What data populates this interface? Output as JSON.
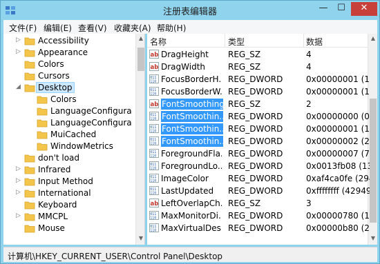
{
  "window": {
    "title": "注册表编辑器",
    "min": "—",
    "max": "☐",
    "close": "✕"
  },
  "menu": [
    "文件(F)",
    "编辑(E)",
    "查看(V)",
    "收藏夹(A)",
    "帮助(H)"
  ],
  "tree": [
    {
      "label": "Accessibility",
      "level": 1,
      "expand": "▷"
    },
    {
      "label": "Appearance",
      "level": 1,
      "expand": "▷"
    },
    {
      "label": "Colors",
      "level": 1,
      "expand": ""
    },
    {
      "label": "Cursors",
      "level": 1,
      "expand": ""
    },
    {
      "label": "Desktop",
      "level": 1,
      "expand": "◢",
      "selected": true
    },
    {
      "label": "Colors",
      "level": 2,
      "expand": ""
    },
    {
      "label": "LanguageConfigura",
      "level": 2,
      "expand": ""
    },
    {
      "label": "LanguageConfigura",
      "level": 2,
      "expand": ""
    },
    {
      "label": "MuiCached",
      "level": 2,
      "expand": ""
    },
    {
      "label": "WindowMetrics",
      "level": 2,
      "expand": ""
    },
    {
      "label": "don't load",
      "level": 1,
      "expand": ""
    },
    {
      "label": "Infrared",
      "level": 1,
      "expand": "▷"
    },
    {
      "label": "Input Method",
      "level": 1,
      "expand": "▷"
    },
    {
      "label": "International",
      "level": 1,
      "expand": "▷"
    },
    {
      "label": "Keyboard",
      "level": 1,
      "expand": ""
    },
    {
      "label": "MMCPL",
      "level": 1,
      "expand": "▷"
    },
    {
      "label": "Mouse",
      "level": 1,
      "expand": ""
    }
  ],
  "columns": {
    "name": "名称",
    "type": "类型",
    "data": "数据"
  },
  "rows": [
    {
      "icon": "ab",
      "name": "DragHeight",
      "type": "REG_SZ",
      "data": "4"
    },
    {
      "icon": "ab",
      "name": "DragWidth",
      "type": "REG_SZ",
      "data": "4"
    },
    {
      "icon": "bin",
      "name": "FocusBorderH...",
      "type": "REG_DWORD",
      "data": "0x00000001 (1)"
    },
    {
      "icon": "bin",
      "name": "FocusBorderW...",
      "type": "REG_DWORD",
      "data": "0x00000001 (1)"
    },
    {
      "icon": "ab",
      "name": "FontSmoothing",
      "type": "REG_SZ",
      "data": "2",
      "selected": true
    },
    {
      "icon": "bin",
      "name": "FontSmoothin...",
      "type": "REG_DWORD",
      "data": "0x00000000 (0)",
      "selected": true
    },
    {
      "icon": "bin",
      "name": "FontSmoothin...",
      "type": "REG_DWORD",
      "data": "0x00000001 (1)",
      "selected": true
    },
    {
      "icon": "bin",
      "name": "FontSmoothin...",
      "type": "REG_DWORD",
      "data": "0x00000002 (2)",
      "selected": true
    },
    {
      "icon": "bin",
      "name": "ForegroundFla...",
      "type": "REG_DWORD",
      "data": "0x00000007 (7)"
    },
    {
      "icon": "bin",
      "name": "ForegroundLo...",
      "type": "REG_DWORD",
      "data": "0x0013fb08 (13"
    },
    {
      "icon": "bin",
      "name": "ImageColor",
      "type": "REG_DWORD",
      "data": "0xaf4ca0fe (294"
    },
    {
      "icon": "bin",
      "name": "LastUpdated",
      "type": "REG_DWORD",
      "data": "0xffffffff (42949"
    },
    {
      "icon": "ab",
      "name": "LeftOverlapCh...",
      "type": "REG_SZ",
      "data": "3"
    },
    {
      "icon": "bin",
      "name": "MaxMonitorDi...",
      "type": "REG_DWORD",
      "data": "0x00000780 (19"
    },
    {
      "icon": "bin",
      "name": "MaxVirtualDes...",
      "type": "REG_DWORD",
      "data": "0x00000b80 (29"
    }
  ],
  "status": "计算机\\HKEY_CURRENT_USER\\Control Panel\\Desktop"
}
